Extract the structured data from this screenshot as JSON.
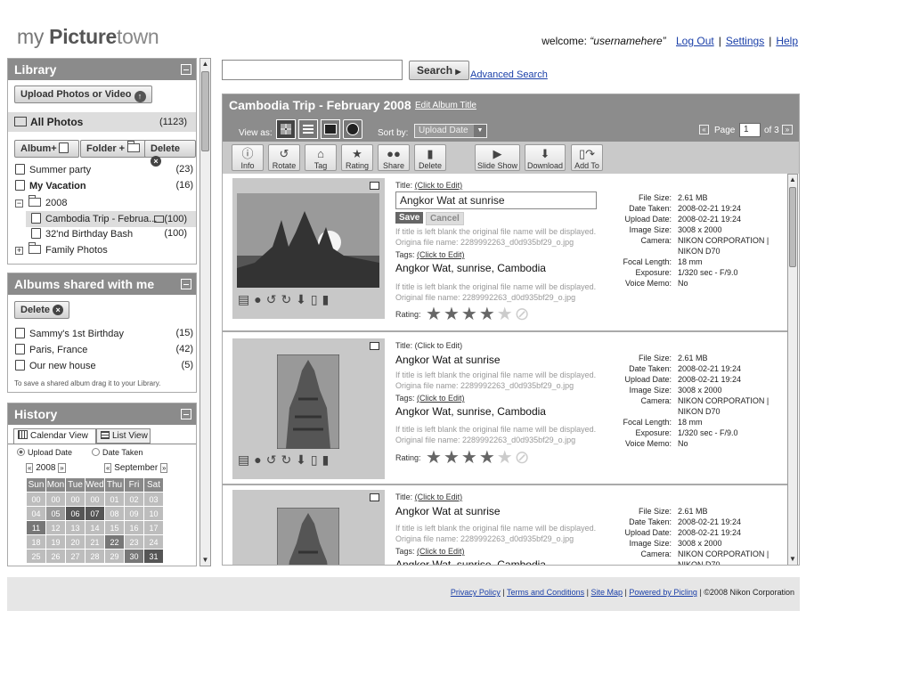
{
  "header": {
    "logo_my": "my",
    "logo_picture": "Picture",
    "logo_town": "town",
    "welcome": "welcome:",
    "username": "“usernamehere”",
    "logout": "Log Out",
    "settings": "Settings",
    "help": "Help",
    "sep": "|"
  },
  "library": {
    "title": "Library",
    "upload": "Upload Photos or Video",
    "all_photos": "All Photos",
    "all_count": "(1123)",
    "album_btn": "Album+",
    "folder_btn": "Folder +",
    "delete_btn": "Delete",
    "items": [
      {
        "label": "Summer party",
        "count": "(23)"
      },
      {
        "label": "My Vacation",
        "count": "(16)"
      },
      {
        "label": "2008",
        "count": ""
      },
      {
        "label": "Cambodia Trip - Februa...",
        "count": "(100)"
      },
      {
        "label": "32'nd Birthday Bash",
        "count": "(100)"
      },
      {
        "label": "Family Photos",
        "count": ""
      }
    ]
  },
  "shared": {
    "title": "Albums shared with me",
    "delete_btn": "Delete",
    "items": [
      {
        "label": "Sammy's 1st Birthday",
        "count": "(15)"
      },
      {
        "label": "Paris, France",
        "count": "(42)"
      },
      {
        "label": "Our new house",
        "count": "(5)"
      }
    ],
    "hint": "To save a shared album drag it to your Library."
  },
  "history": {
    "title": "History",
    "tab_calendar": "Calendar View",
    "tab_list": "List View",
    "radio_upload": "Upload Date",
    "radio_taken": "Date Taken",
    "year": "2008",
    "month": "September",
    "days": [
      "Sun",
      "Mon",
      "Tue",
      "Wed",
      "Thu",
      "Fri",
      "Sat"
    ],
    "weeks": [
      [
        "00",
        "00",
        "00",
        "00",
        "01",
        "02",
        "03"
      ],
      [
        "04",
        "05",
        "06",
        "07",
        "08",
        "09",
        "10"
      ],
      [
        "11",
        "12",
        "13",
        "14",
        "15",
        "16",
        "17"
      ],
      [
        "18",
        "19",
        "20",
        "21",
        "22",
        "23",
        "24"
      ],
      [
        "25",
        "26",
        "27",
        "28",
        "29",
        "30",
        "31"
      ]
    ]
  },
  "search": {
    "placeholder": "",
    "button": "Search",
    "advanced": "Advanced Search"
  },
  "album": {
    "title": "Cambodia Trip - February 2008",
    "edit": "Edit Album Title",
    "view_as": "View as:",
    "sort_by": "Sort by:",
    "sort_value": "Upload Date",
    "page_label": "Page",
    "page": "1",
    "of": "of 3"
  },
  "toolbar": [
    "Info",
    "Rotate",
    "Tag",
    "Rating",
    "Share",
    "Delete",
    "Slide Show",
    "Download",
    "Add To"
  ],
  "photo": {
    "title_label": "Title: ",
    "click_edit": "(Click to Edit)",
    "title_value": "Angkor Wat at sunrise",
    "save": "Save",
    "cancel": "Cancel",
    "note1": "If title is left blank the original file name will be displayed.",
    "orig": "Origina file name:  2289992263_d0d935bf29_o.jpg",
    "orig2": "Original file name:   2289992263_d0d935bf29_o.jpg",
    "tags_label": "Tags: ",
    "tags_value": "Angkor Wat, sunrise, Cambodia",
    "rating_label": "Rating:",
    "meta": [
      {
        "k": "File Size:",
        "v": "2.61 MB"
      },
      {
        "k": "Date Taken:",
        "v": "2008-02-21 19:24"
      },
      {
        "k": "Upload Date:",
        "v": "2008-02-21 19:24"
      },
      {
        "k": "Image Size:",
        "v": "3008 x 2000"
      },
      {
        "k": "Camera:",
        "v": "NIKON CORPORATION |"
      },
      {
        "k": "",
        "v": "NIKON D70"
      },
      {
        "k": "Focal Length:",
        "v": "18 mm"
      },
      {
        "k": "Exposure:",
        "v": "1/320 sec - F/9.0"
      },
      {
        "k": "Voice Memo:",
        "v": "No"
      }
    ]
  },
  "footer": {
    "privacy": "Privacy Policy",
    "terms": "Terms and Conditions",
    "sitemap": "Site Map",
    "powered": "Powered by Picling",
    "copy": "©2008 Nikon Corporation",
    "sep": "|"
  }
}
